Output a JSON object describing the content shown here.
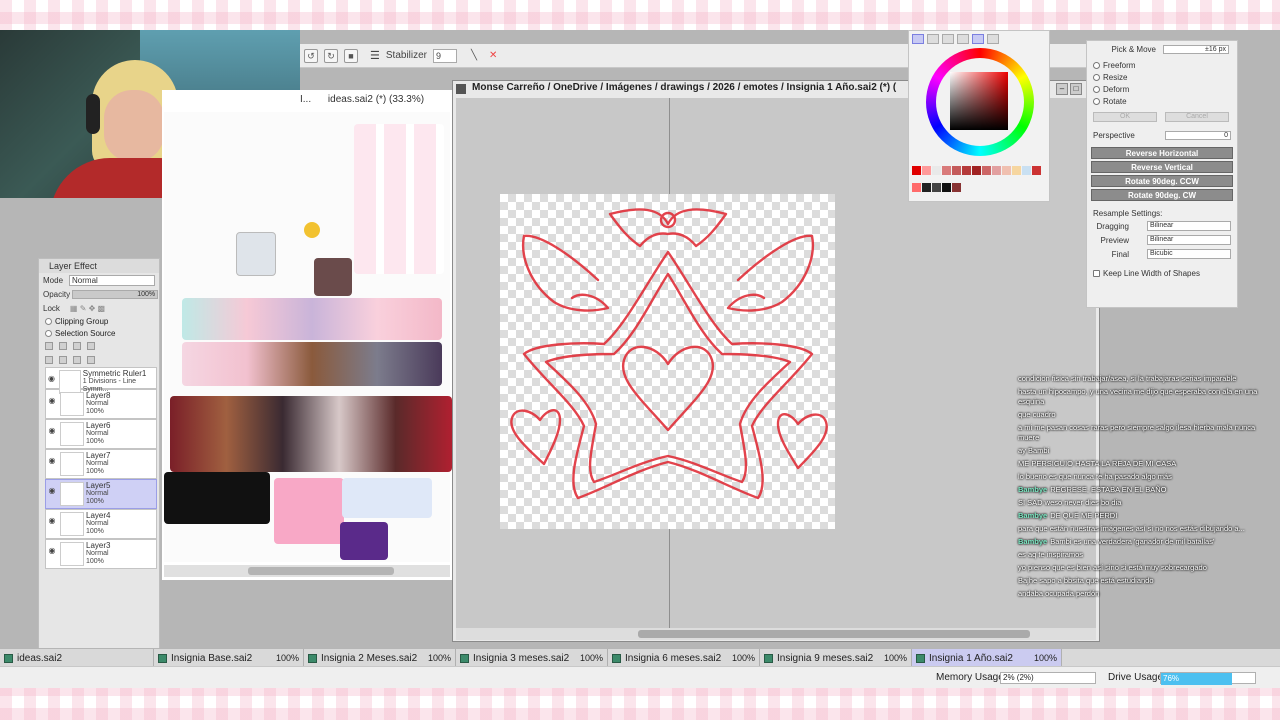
{
  "toolbar": {
    "stabilizer_label": "Stabilizer",
    "stabilizer_value": "9",
    "icons": [
      "undo-icon",
      "redo-icon",
      "stop-icon",
      "menu-icon",
      "line-icon",
      "pin-icon"
    ]
  },
  "layer_panel": {
    "title": "Layer Effect",
    "mode_label": "Mode",
    "mode_value": "Normal",
    "opacity_label": "Opacity",
    "opacity_value": "100%",
    "lock_label": "Lock",
    "clipping_label": "Clipping Group",
    "selection_label": "Selection Source",
    "layers": [
      {
        "name": "Symmetric Ruler1",
        "sub": "1 Divisions - Line Symm...",
        "mode": "",
        "opacity": ""
      },
      {
        "name": "Layer8",
        "mode": "Normal",
        "opacity": "100%"
      },
      {
        "name": "Layer6",
        "mode": "Normal",
        "opacity": "100%"
      },
      {
        "name": "Layer7",
        "mode": "Normal",
        "opacity": "100%"
      },
      {
        "name": "Layer5",
        "mode": "Normal",
        "opacity": "100%",
        "selected": true
      },
      {
        "name": "Layer4",
        "mode": "Normal",
        "opacity": "100%"
      },
      {
        "name": "Layer3",
        "mode": "Normal",
        "opacity": "100%"
      }
    ]
  },
  "ideas_window": {
    "title_prefix": "I...",
    "title": "ideas.sai2 (*) (33.3%)"
  },
  "canvas_window": {
    "title": "Monse Carreño / OneDrive / Imágenes / drawings / 2026 / emotes / Insignia 1 Año.sai2 (*) ("
  },
  "transform_panel": {
    "pick_move_label": "Pick & Move",
    "pick_move_value": "±16 px",
    "modes": [
      "Freeform",
      "Resize",
      "Deform",
      "Rotate"
    ],
    "ok_label": "OK",
    "cancel_label": "Cancel",
    "perspective_label": "Perspective",
    "perspective_value": "0",
    "buttons": [
      "Reverse Horizontal",
      "Reverse Vertical",
      "Rotate 90deg. CCW",
      "Rotate 90deg. CW"
    ],
    "resample_label": "Resample Settings:",
    "dragging_label": "Dragging",
    "dragging_value": "Bilinear",
    "preview_label": "Preview",
    "preview_value": "Bilinear",
    "final_label": "Final",
    "final_value": "Bicubic",
    "keep_line_label": "Keep Line Width of Shapes"
  },
  "color_panel": {
    "swatches": [
      "#e00000",
      "#ff9a9a",
      "#e9e9e9",
      "#d97a7a",
      "#c45a5a",
      "#b53a3a",
      "#a02222",
      "#cc6666",
      "#e2a0a0",
      "#f0c0b0",
      "#f6d6a0",
      "#c9e0f2",
      "#cc3333",
      "#ff6b6b",
      "#222222",
      "#444444",
      "#111111",
      "#883333"
    ]
  },
  "chat": {
    "lines": [
      {
        "user": "",
        "text": "condicion fisica sin trabajar/asea, si la trabajaras serias imparable"
      },
      {
        "user": "",
        "text": "hasta un hipocampo, y una vecina me dijo que esperaba con ala en una esquina"
      },
      {
        "user": "",
        "text": "que cuadro"
      },
      {
        "user": "",
        "text": "a mi me pasan cosas raras pero siempre salgo ilesa hierba mala nunca muere"
      },
      {
        "user": "",
        "text": "ay Bambi"
      },
      {
        "user": "",
        "text": "ME PERSIGUIO HASTA LA REJA DE MI CASA"
      },
      {
        "user": "",
        "text": "lo bueno es que nunca te ha pasado algo más"
      },
      {
        "user": "Bambye",
        "text": "REGRESE, ESTABA EN EL BAÑO",
        "green": true
      },
      {
        "user": "",
        "text": "SI SAD weso never dies bo dia"
      },
      {
        "user": "Bambye",
        "text": "DE QUE ME PERDI",
        "green": true
      },
      {
        "user": "",
        "text": "para que están nuestras imágenes así si no nos estás dibujando a..."
      },
      {
        "user": "Bambye",
        "text": "Bambi es una verdadera 'ganador de mil batallas'",
        "green": true
      },
      {
        "user": "",
        "text": "es aq te inspiramos"
      },
      {
        "user": "",
        "text": "yo pienso que es bien así sino si está muy sobrecargado"
      },
      {
        "user": "",
        "text": "Bajhe sapo a bbsita que está estudiando"
      },
      {
        "user": "",
        "text": "andaba ocupada perdón"
      }
    ]
  },
  "file_tabs": [
    {
      "name": "ideas.sai2",
      "zoom": "",
      "active": false
    },
    {
      "name": "Insignia Base.sai2",
      "zoom": "100%",
      "active": false
    },
    {
      "name": "Insignia 2 Meses.sai2",
      "zoom": "100%",
      "active": false
    },
    {
      "name": "Insignia 3 meses.sai2",
      "zoom": "100%",
      "active": false
    },
    {
      "name": "Insignia 6 meses.sai2",
      "zoom": "100%",
      "active": false
    },
    {
      "name": "Insignia 9 meses.sai2",
      "zoom": "100%",
      "active": false
    },
    {
      "name": "Insignia 1 Año.sai2",
      "zoom": "100%",
      "active": true
    }
  ],
  "status": {
    "memory_label": "Memory Usage",
    "memory_value": "2% (2%)",
    "memory_fraction": 0.02,
    "drive_label": "Drive Usage",
    "drive_value": "76%",
    "drive_fraction": 0.76
  },
  "colors": {
    "accent": "#cbcbf0",
    "sketch_red": "#e0303a",
    "drive_bar": "#4cc0f0"
  }
}
